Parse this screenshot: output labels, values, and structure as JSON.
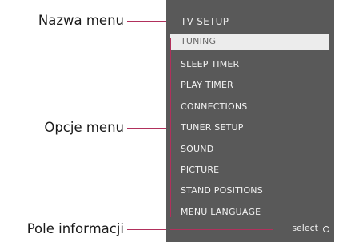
{
  "callouts": {
    "menu_name": "Nazwa menu",
    "menu_options": "Opcje menu",
    "info_field": "Pole  informacji"
  },
  "tv_menu": {
    "title": "TV SETUP",
    "items": [
      {
        "label": "TUNING",
        "selected": true
      },
      {
        "label": "SLEEP TIMER",
        "selected": false
      },
      {
        "label": "PLAY TIMER",
        "selected": false
      },
      {
        "label": "CONNECTIONS",
        "selected": false
      },
      {
        "label": "TUNER SETUP",
        "selected": false
      },
      {
        "label": "SOUND",
        "selected": false
      },
      {
        "label": "PICTURE",
        "selected": false
      },
      {
        "label": "STAND POSITIONS",
        "selected": false
      },
      {
        "label": "MENU LANGUAGE",
        "selected": false
      }
    ],
    "info": {
      "select_label": "select"
    }
  },
  "colors": {
    "panel_bg": "#595959",
    "callout_line": "#b1305c",
    "selected_bg": "#ececec"
  }
}
